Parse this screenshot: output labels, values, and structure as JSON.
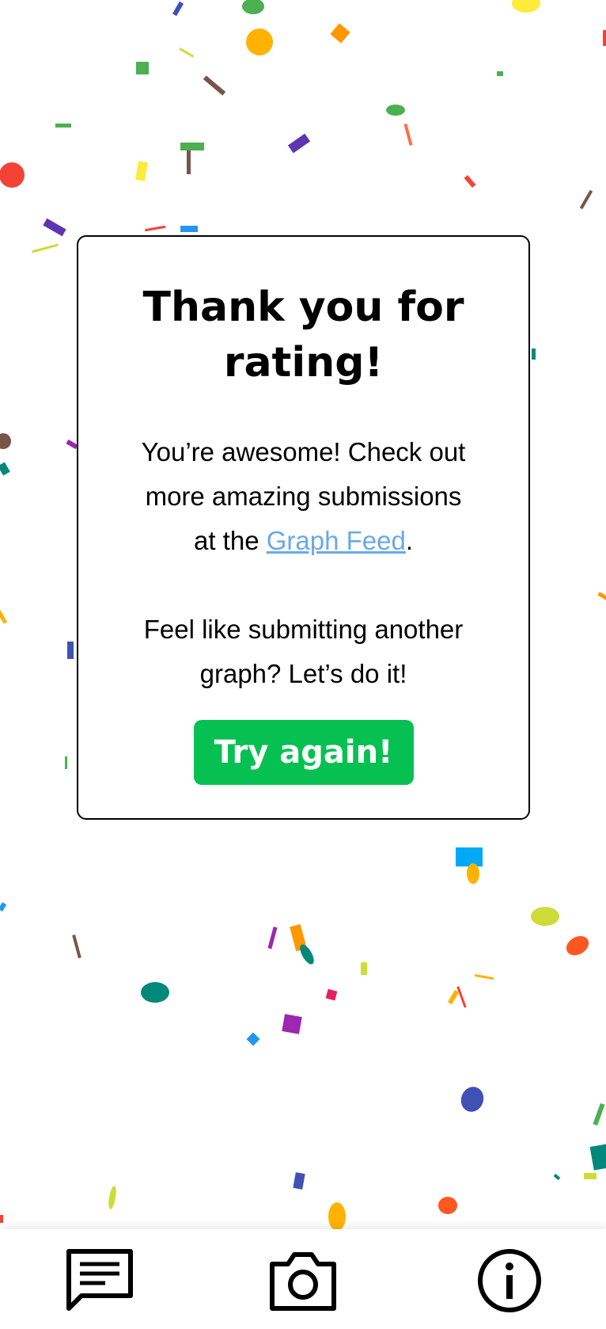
{
  "dialog": {
    "title_line1": "Thank you for",
    "title_line2": "rating!",
    "para1_line1": "You’re awesome! Check out",
    "para1_line2": "more amazing submissions",
    "para1_line3_pre": "at the ",
    "link_text": "Graph Feed",
    "para1_line3_post": ".",
    "para2_line1": "Feel like submitting another",
    "para2_line2": "graph? Let’s do it!",
    "button_label": "Try again!"
  },
  "bottom_nav": {
    "items": [
      {
        "icon": "message-icon"
      },
      {
        "icon": "camera-icon"
      },
      {
        "icon": "info-icon"
      }
    ]
  },
  "colors": {
    "accent": "#06c152",
    "link": "#6aa9ea",
    "confetti": [
      "#f44336",
      "#ffb300",
      "#4caf50",
      "#3f51b5",
      "#9c27b0",
      "#00897b",
      "#795548",
      "#ffeb3b",
      "#cddc39",
      "#2196f3",
      "#ff7043",
      "#e91e63"
    ]
  }
}
